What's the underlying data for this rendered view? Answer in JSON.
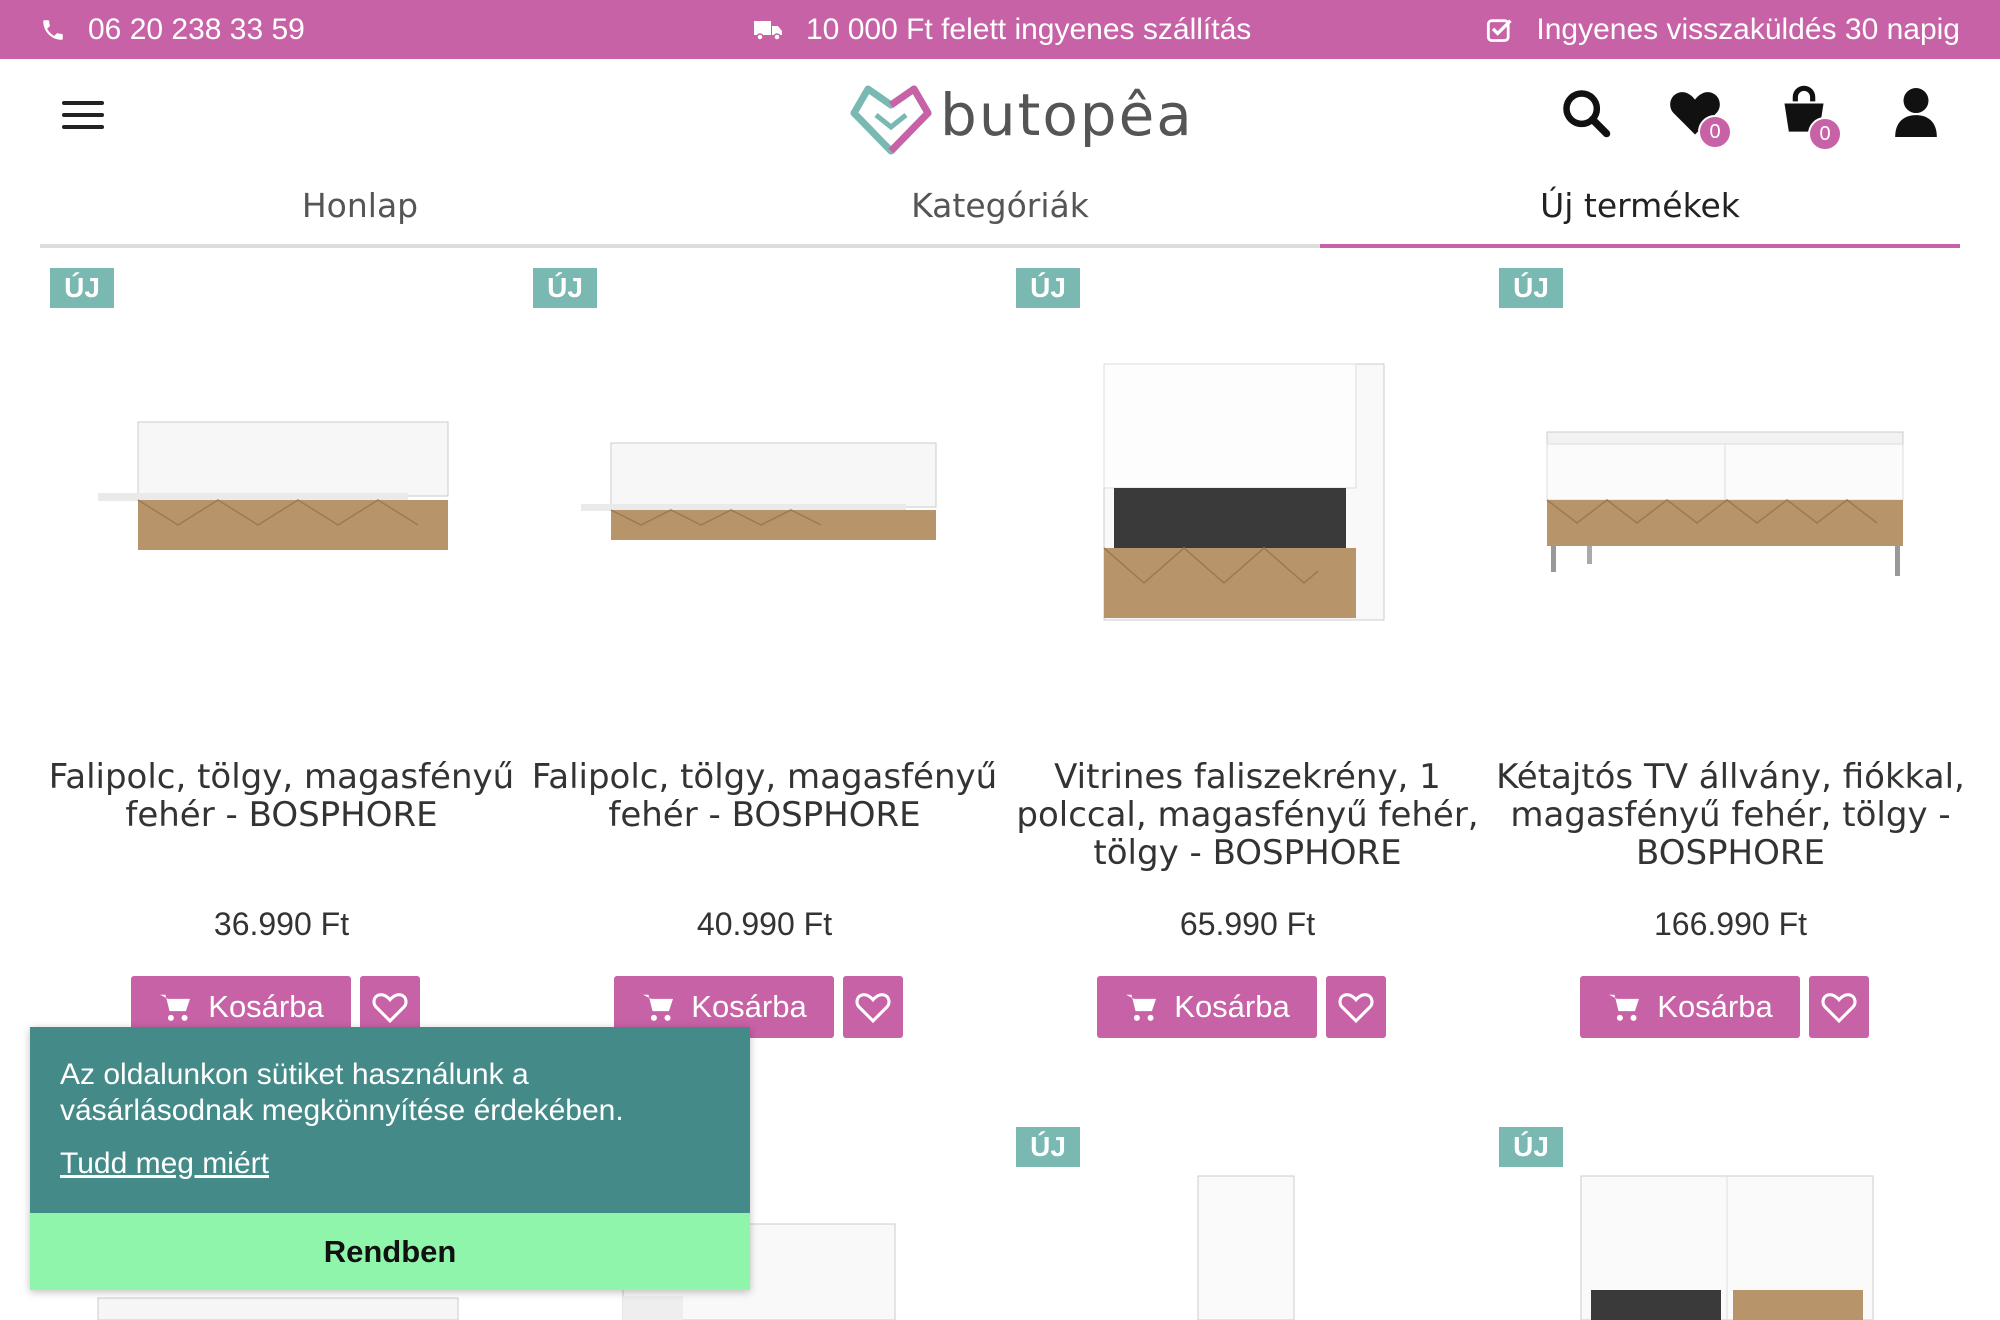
{
  "topbar": {
    "phone": "06 20 238 33 59",
    "shipping": "10 000 Ft felett ingyenes szállítás",
    "returns": "Ingyenes visszaküldés 30 napig"
  },
  "header": {
    "logo_text": "butopêa",
    "wishlist_count": "0",
    "cart_count": "0"
  },
  "tabs": [
    {
      "label": "Honlap"
    },
    {
      "label": "Kategóriák"
    },
    {
      "label": "Új termékek"
    }
  ],
  "badge_new": "ÚJ",
  "products": [
    {
      "title": "Falipolc, tölgy, magasfényű fehér - BOSPHORE",
      "price": "36.990 Ft"
    },
    {
      "title": "Falipolc, tölgy, magasfényű fehér - BOSPHORE",
      "price": "40.990 Ft"
    },
    {
      "title": "Vitrines faliszekrény, 1 polccal, magasfényű fehér, tölgy - BOSPHORE",
      "price": "65.990 Ft"
    },
    {
      "title": "Kétajtós TV állvány, fiókkal, magasfényű fehér, tölgy - BOSPHORE",
      "price": "166.990 Ft"
    }
  ],
  "cart_button_label": "Kosárba",
  "cookie": {
    "message": "Az oldalunkon sütiket használunk a vásárlásodnak megkönnyítése érdekében.",
    "link": "Tudd meg miért",
    "button": "Rendben"
  },
  "colors": {
    "accent": "#c862a6",
    "badge": "#7ab8b2",
    "cookie_bg": "#438a88",
    "cookie_button": "#8ff5ab"
  }
}
